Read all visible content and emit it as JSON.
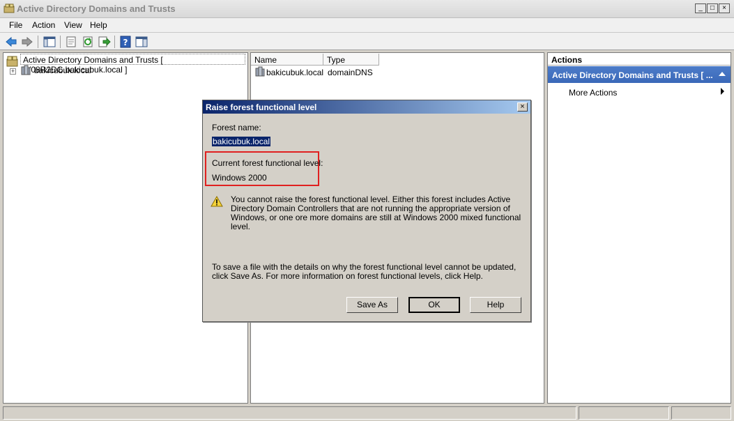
{
  "window": {
    "title": "Active Directory Domains and Trusts",
    "controls": {
      "minimize": "_",
      "maximize": "□",
      "close": "×"
    }
  },
  "menu": [
    "File",
    "Action",
    "View",
    "Help"
  ],
  "toolbar": {
    "icons": [
      "back-arrow-icon",
      "forward-arrow-icon",
      "show-hide-tree-icon",
      "properties-icon",
      "refresh-icon",
      "export-list-icon",
      "help-icon",
      "show-hide-action-pane-icon"
    ]
  },
  "tree": {
    "root_label": "Active Directory Domains and Trusts [ W08R2DC.bakicubuk.local ]",
    "children": [
      {
        "label": "bakicubuk.local",
        "expander": "+"
      }
    ]
  },
  "list": {
    "columns": [
      "Name",
      "Type"
    ],
    "rows": [
      {
        "name": "bakicubuk.local",
        "type": "domainDNS"
      }
    ]
  },
  "actions": {
    "header": "Actions",
    "group_title": "Active Directory Domains and Trusts [ ...",
    "items": [
      "More Actions"
    ]
  },
  "dialog": {
    "title": "Raise forest functional level",
    "close": "×",
    "forest_name_label": "Forest name:",
    "forest_name_value": "bakicubuk.local",
    "current_level_label": "Current forest functional level:",
    "current_level_value": "Windows 2000",
    "warning_text": "You cannot raise the forest functional level. Either this forest includes Active Directory Domain Controllers that are not running the appropriate version of Windows, or one ore more domains are still at Windows 2000 mixed functional level.",
    "save_info_text": "To save a file with the details on why the forest functional level cannot be updated, click Save As. For more information on forest functional levels, click Help.",
    "buttons": {
      "save_as": "Save As",
      "ok": "OK",
      "help": "Help"
    }
  },
  "colors": {
    "dialog_title_start": "#0a246a",
    "dialog_title_end": "#a6caf0",
    "actions_group": "#3a68b8",
    "highlight": "#e02020",
    "selection": "#0a246a"
  }
}
